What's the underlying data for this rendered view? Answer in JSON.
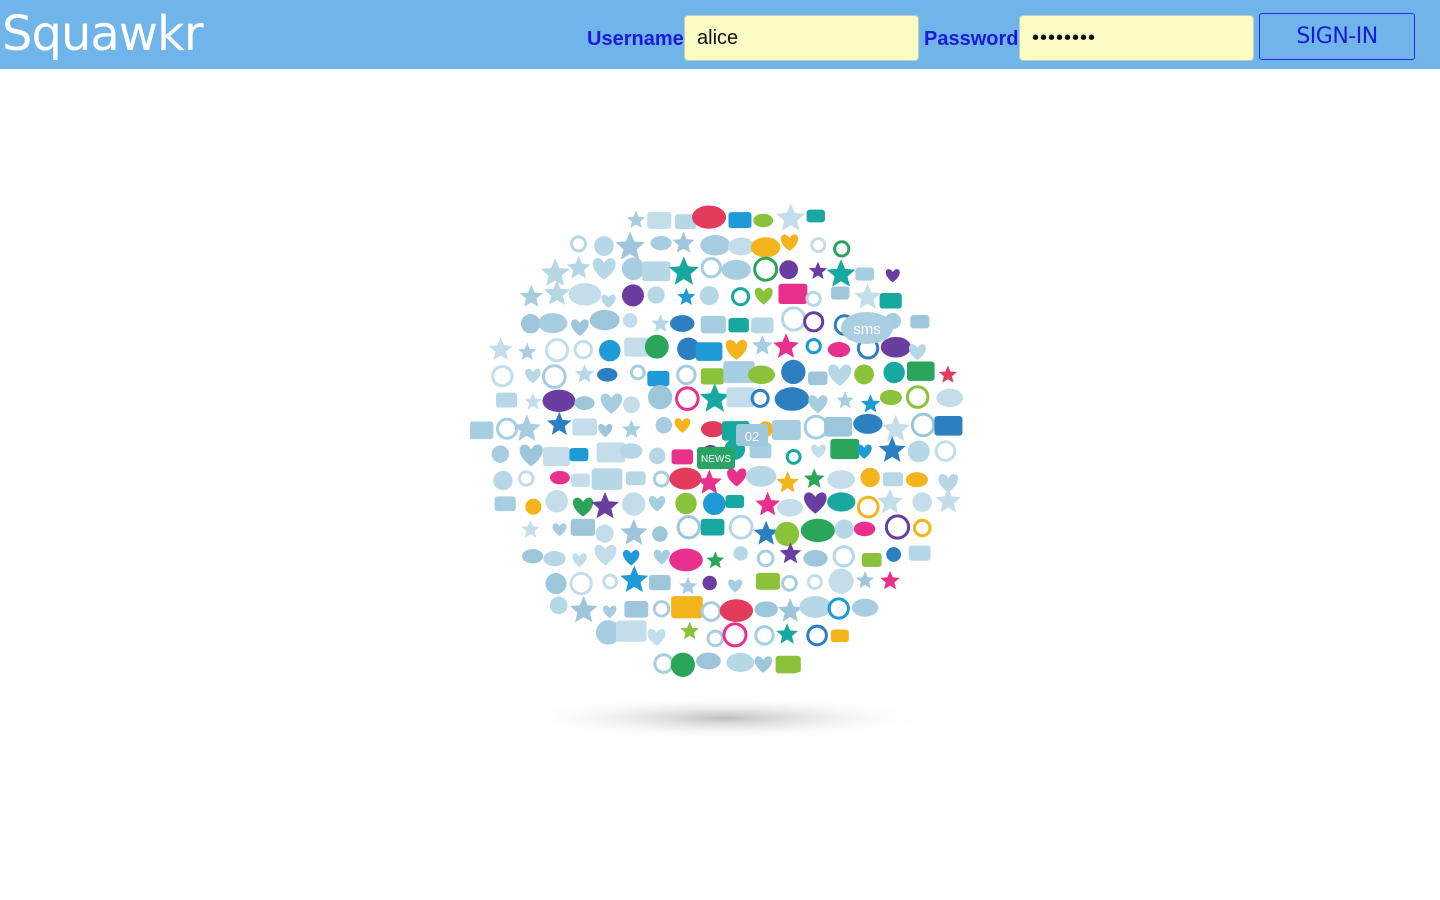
{
  "header": {
    "logo_text": "Squawkr",
    "background_color": "#6fb5e9"
  },
  "login": {
    "username_label": "Username",
    "username_value": "alice",
    "password_label": "Password",
    "password_value": "••••••••",
    "signin_label": "SIGN-IN",
    "label_color": "#1a1ad8",
    "field_color": "#fafcc3"
  },
  "hero": {
    "icons": [
      "twitter-bird-icon",
      "chat-bubble-icon",
      "cloud-upload-icon",
      "globe-icon",
      "shopping-cart-icon",
      "phone-icon",
      "sms-bubble-icon",
      "news-icon",
      "calendar-icon",
      "magnifier-icon",
      "gear-icon",
      "microphone-icon",
      "music-note-icon",
      "star-icon",
      "heart-icon",
      "thumbs-up-icon",
      "envelope-icon",
      "laptop-icon",
      "camera-icon",
      "user-icon",
      "wifi-icon"
    ],
    "badge_texts": [
      "sms",
      "NEWS",
      "02"
    ]
  }
}
